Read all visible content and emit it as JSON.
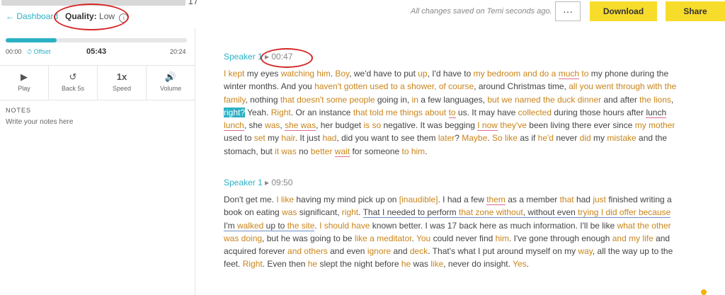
{
  "header": {
    "filename_suffix": "17",
    "back_label": "← Dashboard",
    "quality_label": "Quality:",
    "quality_value": "Low",
    "quality_info_glyph": "i",
    "saved_status": "All changes saved on Temi seconds ago.",
    "more_label": "···",
    "download_label": "Download",
    "share_label": "Share"
  },
  "player": {
    "progress_fraction": 0.28,
    "time_start": "00:00",
    "offset_label": "Offset",
    "time_current": "05:43",
    "time_end": "20:24",
    "controls": [
      {
        "label": "Play",
        "icon": "play-icon",
        "glyph": "▶"
      },
      {
        "label": "Back 5s",
        "icon": "rewind-icon",
        "glyph": "↺"
      },
      {
        "label": "Speed",
        "icon": "speed-text",
        "glyph": "1x"
      },
      {
        "label": "Volume",
        "icon": "volume-icon",
        "glyph": "🔊"
      }
    ]
  },
  "notes": {
    "heading": "NOTES",
    "placeholder": "Write your notes here"
  },
  "transcript": {
    "play_glyph": "▸",
    "blocks": [
      {
        "speaker": "Speaker 1",
        "timestamp": "00:47",
        "segments": [
          {
            "t": "I kept",
            "c": "o"
          },
          {
            "t": " my eyes "
          },
          {
            "t": "watching him",
            "c": "o"
          },
          {
            "t": ". "
          },
          {
            "t": "Boy",
            "c": "o"
          },
          {
            "t": ", we'd have to put "
          },
          {
            "t": "up",
            "c": "o"
          },
          {
            "t": ", I'd have to "
          },
          {
            "t": "my bedroom and do a",
            "c": "o"
          },
          {
            "t": " "
          },
          {
            "t": "much",
            "c": "o u"
          },
          {
            "t": " "
          },
          {
            "t": "to",
            "c": "o"
          },
          {
            "t": " my phone during the winter months. And you "
          },
          {
            "t": "haven't gotten used to a shower, of course",
            "c": "o"
          },
          {
            "t": ", around Christmas time, "
          },
          {
            "t": "all you went through with the family",
            "c": "o"
          },
          {
            "t": ", nothing "
          },
          {
            "t": "that doesn't some people",
            "c": "o"
          },
          {
            "t": " going in, "
          },
          {
            "t": "in",
            "c": "o"
          },
          {
            "t": " a few languages, "
          },
          {
            "t": "but we named the duck dinner",
            "c": "o"
          },
          {
            "t": " and after "
          },
          {
            "t": "the lions",
            "c": "o"
          },
          {
            "t": ", "
          },
          {
            "t": "right?",
            "c": "hl"
          },
          {
            "t": " Yeah. "
          },
          {
            "t": "Right",
            "c": "o"
          },
          {
            "t": ". Or an instance "
          },
          {
            "t": "that told me things about",
            "c": "o"
          },
          {
            "t": " "
          },
          {
            "t": "to",
            "c": "o u"
          },
          {
            "t": " us. It may have "
          },
          {
            "t": "collected",
            "c": "o"
          },
          {
            "t": " during those hours after "
          },
          {
            "t": "lunch",
            "c": "u"
          },
          {
            "t": " "
          },
          {
            "t": "lunch",
            "c": "o u"
          },
          {
            "t": ", she "
          },
          {
            "t": "was",
            "c": "o"
          },
          {
            "t": ", "
          },
          {
            "t": "she was",
            "c": "o u"
          },
          {
            "t": ", her budget "
          },
          {
            "t": "is so",
            "c": "o"
          },
          {
            "t": " negative. It was begging "
          },
          {
            "t": "I now",
            "c": "o u"
          },
          {
            "t": " "
          },
          {
            "t": "they've",
            "c": "o"
          },
          {
            "t": " been living there ever since "
          },
          {
            "t": "my mother",
            "c": "o"
          },
          {
            "t": " used to "
          },
          {
            "t": "set",
            "c": "o"
          },
          {
            "t": " my "
          },
          {
            "t": "hair",
            "c": "o"
          },
          {
            "t": ". It just "
          },
          {
            "t": "had",
            "c": "o"
          },
          {
            "t": ", did you want to see them "
          },
          {
            "t": "later",
            "c": "o"
          },
          {
            "t": "? "
          },
          {
            "t": "Maybe",
            "c": "o"
          },
          {
            "t": ". "
          },
          {
            "t": "So like",
            "c": "o"
          },
          {
            "t": " as if "
          },
          {
            "t": "he'd",
            "c": "o"
          },
          {
            "t": " never "
          },
          {
            "t": "did",
            "c": "o"
          },
          {
            "t": " my "
          },
          {
            "t": "mistake",
            "c": "o"
          },
          {
            "t": " and the stomach, but "
          },
          {
            "t": "it was",
            "c": "o"
          },
          {
            "t": " no "
          },
          {
            "t": "better",
            "c": "o"
          },
          {
            "t": " "
          },
          {
            "t": "wait",
            "c": "o u"
          },
          {
            "t": " for someone "
          },
          {
            "t": "to him",
            "c": "o"
          },
          {
            "t": "."
          }
        ]
      },
      {
        "speaker": "Speaker 1",
        "timestamp": "09:50",
        "segments": [
          {
            "t": "Don't get me. "
          },
          {
            "t": "I like",
            "c": "o"
          },
          {
            "t": " having my mind pick up on "
          },
          {
            "t": "[inaudible]",
            "c": "o"
          },
          {
            "t": ". I had a few "
          },
          {
            "t": "them",
            "c": "o u"
          },
          {
            "t": " as a member "
          },
          {
            "t": "that",
            "c": "o"
          },
          {
            "t": " had "
          },
          {
            "t": "just",
            "c": "o"
          },
          {
            "t": " finished writing a book on eating "
          },
          {
            "t": "was",
            "c": "o"
          },
          {
            "t": " significant, "
          },
          {
            "t": "right",
            "c": "o"
          },
          {
            "t": ". "
          },
          {
            "t": "That I needed to perform ",
            "c": "bu"
          },
          {
            "t": "that zone without",
            "c": "o bu"
          },
          {
            "t": ", without even ",
            "c": "bu"
          },
          {
            "t": "trying I did offer because",
            "c": "o bu"
          },
          {
            "t": " I'm ",
            "c": "bu"
          },
          {
            "t": "walked",
            "c": "o bu"
          },
          {
            "t": " up to ",
            "c": "bu"
          },
          {
            "t": "the site",
            "c": "o bu"
          },
          {
            "t": ". "
          },
          {
            "t": "I should have",
            "c": "o"
          },
          {
            "t": " known better. I was 17 back here as much information. I'll be like "
          },
          {
            "t": "what the other was doing",
            "c": "o"
          },
          {
            "t": ", but he was going to be "
          },
          {
            "t": "like a meditator",
            "c": "o"
          },
          {
            "t": ". "
          },
          {
            "t": "You",
            "c": "o"
          },
          {
            "t": " could never find "
          },
          {
            "t": "him",
            "c": "o"
          },
          {
            "t": ". I've gone through enough "
          },
          {
            "t": "and my life",
            "c": "o"
          },
          {
            "t": " and acquired forever "
          },
          {
            "t": "and others",
            "c": "o"
          },
          {
            "t": " and even "
          },
          {
            "t": "ignore",
            "c": "o"
          },
          {
            "t": " and "
          },
          {
            "t": "deck",
            "c": "o"
          },
          {
            "t": ". That's what I put around myself on my "
          },
          {
            "t": "way",
            "c": "o"
          },
          {
            "t": ", all the way up to the feet. "
          },
          {
            "t": "Right",
            "c": "o"
          },
          {
            "t": ". Even then "
          },
          {
            "t": "he",
            "c": "o"
          },
          {
            "t": " slept the night before "
          },
          {
            "t": "he",
            "c": "o"
          },
          {
            "t": " was "
          },
          {
            "t": "like",
            "c": "o"
          },
          {
            "t": ", never do insight. "
          },
          {
            "t": "Yes",
            "c": "o"
          },
          {
            "t": "."
          }
        ]
      }
    ]
  },
  "colors": {
    "accent": "#2bb1c4",
    "highlight_word": "#c98419",
    "button_yellow": "#f8dc2b",
    "annotation_red": "#d62626"
  }
}
